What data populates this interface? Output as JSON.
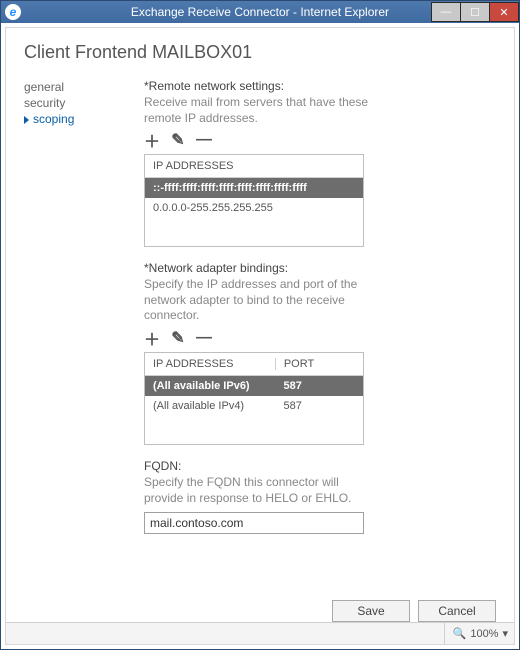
{
  "window": {
    "title": "Exchange Receive Connector - Internet Explorer"
  },
  "page": {
    "heading": "Client Frontend MAILBOX01"
  },
  "sidenav": {
    "items": [
      {
        "label": "general",
        "active": false
      },
      {
        "label": "security",
        "active": false
      },
      {
        "label": "scoping",
        "active": true
      }
    ]
  },
  "remote": {
    "label": "*Remote network settings:",
    "help": "Receive mail from servers that have these remote IP addresses.",
    "header": "IP ADDRESSES",
    "rows": [
      {
        "text": "::-ffff:ffff:ffff:ffff:ffff:ffff:ffff:ffff",
        "selected": true
      },
      {
        "text": "0.0.0.0-255.255.255.255",
        "selected": false
      }
    ]
  },
  "bindings": {
    "label": "*Network adapter bindings:",
    "help": "Specify the IP addresses and port of the network adapter to bind to the receive connector.",
    "header_ip": "IP ADDRESSES",
    "header_port": "PORT",
    "rows": [
      {
        "ip": "(All available IPv6)",
        "port": "587",
        "selected": true
      },
      {
        "ip": "(All available IPv4)",
        "port": "587",
        "selected": false
      }
    ]
  },
  "fqdn": {
    "label": "FQDN:",
    "help": "Specify the FQDN this connector will provide in response to HELO or EHLO.",
    "value": "mail.contoso.com"
  },
  "buttons": {
    "save": "Save",
    "cancel": "Cancel"
  },
  "statusbar": {
    "zoom": "100%"
  },
  "icons": {
    "plus": "＋",
    "edit": "✎",
    "minus": "—",
    "zoom": "🔍",
    "chevron": "▾"
  }
}
